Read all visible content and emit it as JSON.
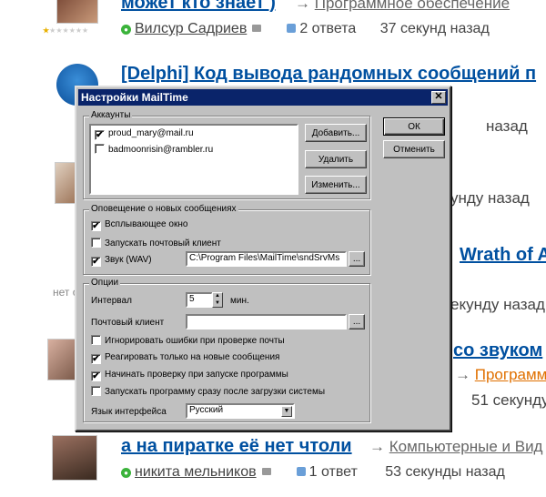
{
  "background": {
    "questions": [
      {
        "title": "может кто знает )",
        "category": "Программное обеспечение",
        "author": "Вилсур Садриев",
        "answers": "2 ответа",
        "time": "37 секунд назад"
      },
      {
        "title": "[Delphi] Код вывода рандомных сообщений п",
        "time_fragment": "назад"
      },
      {
        "time_fragment": "унду назад"
      },
      {
        "title_fragment": "Wrath of A",
        "badge_fragment": "нет о",
        "time_fragment": "екунду назад"
      },
      {
        "title_fragment": "со звуком",
        "category_fragment": "Программ",
        "time_fragment": "51 секунду"
      },
      {
        "title": "а на пиратке её нет чтоли",
        "category": "Компьютерные и Вид",
        "author": "никита мельников",
        "answers": "1 ответ",
        "time": "53 секунды назад"
      }
    ]
  },
  "dialog": {
    "title": "Настройки MailTime",
    "accounts": {
      "legend": "Аккаунты",
      "items": [
        {
          "email": "proud_mary@mail.ru",
          "checked": "✔"
        },
        {
          "email": "badmoonrisin@rambler.ru",
          "checked": ""
        }
      ],
      "add_label": "Добавить...",
      "delete_label": "Удалить",
      "edit_label": "Изменить..."
    },
    "ok_label": "ОК",
    "cancel_label": "Отменить",
    "notify": {
      "legend": "Оповещение о новых сообщениях",
      "popup_label": "Всплывающее окно",
      "popup_checked": "✔",
      "launch_client_label": "Запускать почтовый клиент",
      "launch_client_checked": "",
      "sound_label": "Звук (WAV)",
      "sound_checked": "✔",
      "sound_path": "C:\\Program Files\\MailTime\\sndSrvMs",
      "browse_label": "..."
    },
    "options": {
      "legend": "Опции",
      "interval_label": "Интервал",
      "interval_value": "5",
      "interval_unit": "мин.",
      "client_label": "Почтовый клиент",
      "client_value": "",
      "browse_label": "...",
      "ignore_errors_label": "Игнорировать ошибки при проверке почты",
      "ignore_errors_checked": "",
      "new_only_label": "Реагировать только на новые сообщения",
      "new_only_checked": "✔",
      "check_on_start_label": "Начинать проверку при запуске программы",
      "check_on_start_checked": "✔",
      "autostart_label": "Запускать программу сразу после загрузки системы",
      "autostart_checked": "",
      "language_label": "Язык интерфейса",
      "language_value": "Русский"
    }
  }
}
